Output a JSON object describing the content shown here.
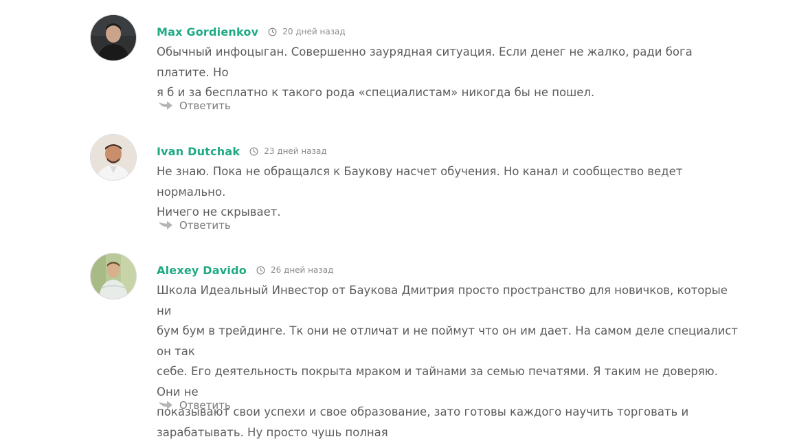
{
  "comments": [
    {
      "author": "Max Gordienkov",
      "date": "20 дней назад",
      "text_lines": [
        "Обычный инфоцыган. Совершенно заурядная ситуация. Если денег не жалко, ради бога платите. Но",
        "я б и за бесплатно к такого рода «специалистам» никогда бы не пошел."
      ],
      "reply_label": "Ответить"
    },
    {
      "author": "Ivan Dutchak",
      "date": "23 дней назад",
      "text_lines": [
        "Не знаю. Пока не обращался к Баукову насчет обучения. Но канал и сообщество ведет нормально.",
        "Ничего не скрывает."
      ],
      "reply_label": "Ответить"
    },
    {
      "author": "Alexey Davido",
      "date": "26 дней назад",
      "text_lines": [
        "Школа Идеальный Инвестор от Баукова Дмитрия просто пространство для новичков, которые ни",
        "бум бум в трейдинге. Тк они не отличат и не поймут что он им дает. На самом деле специалист он так",
        "себе. Его деятельность покрыта мраком и тайнами за семью печатями. Я таким не доверяю. Они не",
        "показывают свои успехи и свое образование, зато готовы каждого научить торговать и",
        "зарабатывать. Ну просто чушь полная"
      ],
      "reply_label": "Ответить"
    }
  ],
  "colors": {
    "author": "#1eaa82",
    "text": "#5c5c5c",
    "meta": "#8a8a8a",
    "reply_icon": "#b5b5b5"
  },
  "icons": {
    "date": "clock-icon",
    "reply": "reply-arrow-icon"
  }
}
